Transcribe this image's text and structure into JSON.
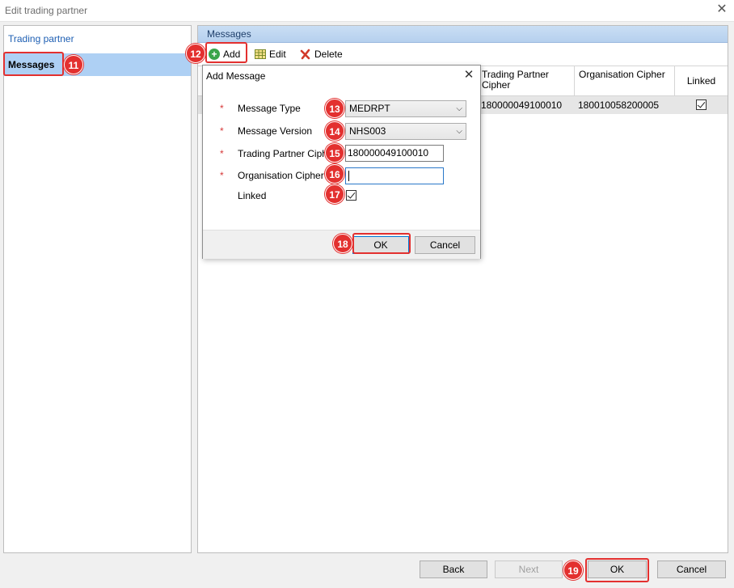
{
  "window": {
    "title": "Edit trading partner",
    "close_glyph": "✕"
  },
  "sidebar": {
    "items": [
      {
        "label": "Trading partner"
      },
      {
        "label": "Messages"
      }
    ]
  },
  "messages_panel": {
    "header": "Messages",
    "toolbar": {
      "add": "Add",
      "edit": "Edit",
      "delete": "Delete"
    },
    "columns": [
      "Trading Partner Cipher",
      "Organisation Cipher",
      "Linked"
    ],
    "rows": [
      {
        "trading_partner_cipher": "180000049100010",
        "organisation_cipher": "180010058200005",
        "linked": true
      }
    ]
  },
  "dialog": {
    "title": "Add Message",
    "fields": {
      "message_type": {
        "label": "Message Type",
        "value": "MEDRPT"
      },
      "message_version": {
        "label": "Message Version",
        "value": "NHS003"
      },
      "trading_partner_cipher": {
        "label": "Trading Partner Cipher",
        "value": "180000049100010"
      },
      "organisation_cipher": {
        "label": "Organisation Cipher",
        "value": ""
      },
      "linked": {
        "label": "Linked",
        "checked": true
      }
    },
    "required_mark": "*",
    "ok": "OK",
    "cancel": "Cancel"
  },
  "footer": {
    "back": "Back",
    "next": "Next",
    "ok": "OK",
    "cancel": "Cancel"
  },
  "callouts": [
    "11",
    "12",
    "13",
    "14",
    "15",
    "16",
    "17",
    "18",
    "19"
  ],
  "colors": {
    "callout": "#e3302f",
    "selection": "#aed0f4",
    "link": "#1e5fb3"
  }
}
